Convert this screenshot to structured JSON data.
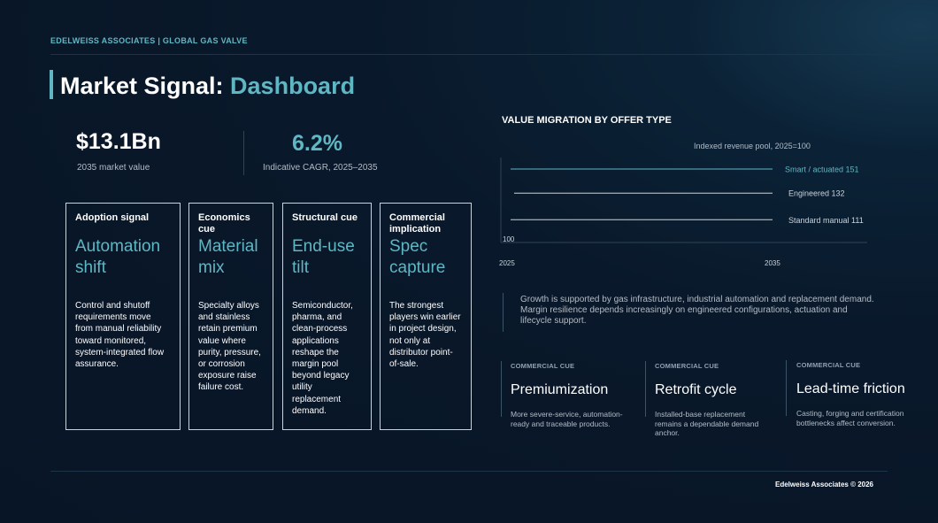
{
  "brand": "EDELWEISS ASSOCIATES | GLOBAL GAS VALVE",
  "title": {
    "main": "Market Signal: ",
    "accent": "Dashboard"
  },
  "kpis": [
    {
      "value": "$13.1Bn",
      "label": "2035 market value"
    },
    {
      "value": "6.2%",
      "label": "Indicative CAGR, 2025–2035"
    }
  ],
  "cards": [
    {
      "head": "Adoption signal",
      "big": "Automation shift",
      "body": "Control and shutoff requirements move from manual reliability toward monitored, system-integrated flow assurance."
    },
    {
      "head": "Economics cue",
      "big": "Material mix",
      "body": "Specialty alloys and stainless retain premium value where purity, pressure, or corrosion exposure raise failure cost."
    },
    {
      "head": "Structural cue",
      "big": "End-use tilt",
      "body": "Semiconductor, pharma, and clean-process applications reshape the margin pool beyond legacy utility replacement demand."
    },
    {
      "head": "Commercial implication",
      "big": "Spec capture",
      "body": "The strongest players win earlier in project design, not only at distributor point-of-sale."
    }
  ],
  "chart_data": {
    "type": "line",
    "title": "VALUE MIGRATION BY OFFER TYPE",
    "subtitle": "Indexed revenue pool, 2025=100",
    "x": [
      "2025",
      "2035"
    ],
    "baseline_label": "100",
    "series": [
      {
        "name": "Smart / actuated",
        "values": [
          100,
          151
        ],
        "color": "#5fb7c4"
      },
      {
        "name": "Engineered",
        "values": [
          100,
          132
        ],
        "color": "#c9d3dc"
      },
      {
        "name": "Standard manual",
        "values": [
          100,
          111
        ],
        "color": "#c9d3dc"
      }
    ]
  },
  "quote": "Growth is supported by gas infrastructure, industrial automation and replacement demand. Margin resilience depends increasingly on engineered configurations, actuation and lifecycle support.",
  "cues": [
    {
      "tag": "COMMERCIAL CUE",
      "title": "Premiumization",
      "body": "More severe-service, automation-ready and traceable products."
    },
    {
      "tag": "COMMERCIAL CUE",
      "title": "Retrofit cycle",
      "body": "Installed-base replacement remains a dependable demand anchor."
    },
    {
      "tag": "COMMERCIAL CUE",
      "title": "Lead-time friction",
      "body": "Casting, forging and certification bottlenecks affect conversion."
    }
  ],
  "footer": "Edelweiss Associates © 2026",
  "colors": {
    "accent": "#5fb7c4",
    "background": "#081526"
  }
}
